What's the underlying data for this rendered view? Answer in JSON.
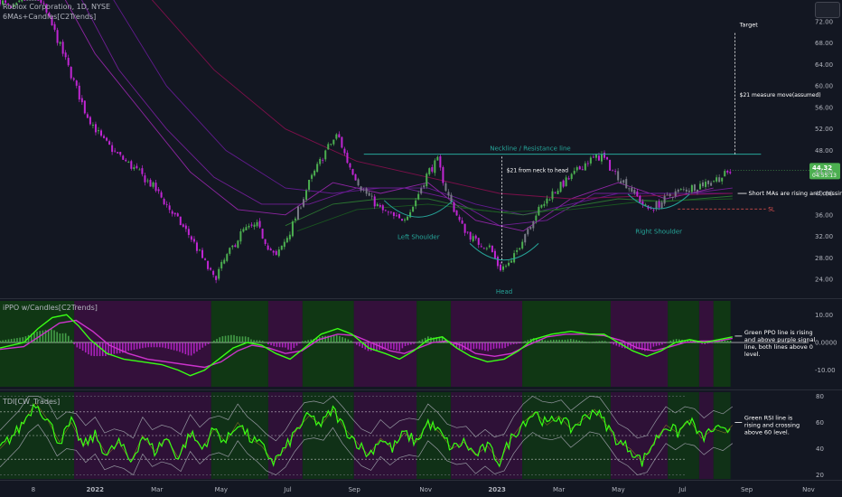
{
  "header": {
    "ticker": "Roblox Corporation, 1D, NYSE",
    "ma_indicator": "6MAs+Candles[C2Trends]"
  },
  "ppo_indicator": {
    "label": "iPPO w/Candles[C2Trends]"
  },
  "rsi_indicator": {
    "label": "TDI[CW_Trades]"
  },
  "colors": {
    "background": "#131722",
    "bull_candle": "#4caf50",
    "bear_candle": "#c026d3",
    "neutral_candle": "#787b86",
    "neckline": "#26a69a",
    "annotation": "#26a69a",
    "note": "#ffffff",
    "stop_loss": "#ef5350",
    "signal_line": "#cc33cc",
    "ppo_line": "#39ff14",
    "bull_zone": "#103d12",
    "bear_zone": "#3b0f40"
  },
  "chart_data": [
    {
      "type": "candlestick",
      "ticker": "Roblox Corporation, 1D, NYSE",
      "x_ticks": [
        "8",
        "2022",
        "Mar",
        "May",
        "Jul",
        "Sep",
        "Nov",
        "2023",
        "Mar",
        "May",
        "Jul",
        "Sep",
        "Nov"
      ],
      "y_ticks": [
        24,
        28,
        32,
        36,
        40,
        44,
        48,
        52,
        56,
        60,
        64,
        68,
        72
      ],
      "y_tick_labels": [
        "24.00",
        "28.00",
        "32.00",
        "36.00",
        "40.00",
        "44.00",
        "48.00",
        "52.00",
        "56.00",
        "60.00",
        "64.00",
        "68.00",
        "72.00"
      ],
      "ylim": [
        21,
        76
      ],
      "close_path": [
        [
          0,
          76
        ],
        [
          0.5,
          74
        ],
        [
          1.5,
          78
        ],
        [
          2.3,
          70
        ],
        [
          3.0,
          62
        ],
        [
          3.6,
          55
        ],
        [
          4.3,
          50
        ],
        [
          5.0,
          47
        ],
        [
          5.8,
          44
        ],
        [
          6.5,
          41
        ],
        [
          7.3,
          36
        ],
        [
          8.0,
          32
        ],
        [
          8.5,
          28
        ],
        [
          9.0,
          24
        ],
        [
          9.5,
          28
        ],
        [
          10.2,
          33
        ],
        [
          10.8,
          34
        ],
        [
          11.3,
          30
        ],
        [
          11.6,
          28
        ],
        [
          12.2,
          33
        ],
        [
          13.0,
          42
        ],
        [
          13.7,
          48
        ],
        [
          14.2,
          51
        ],
        [
          14.6,
          46
        ],
        [
          15.2,
          41
        ],
        [
          16.0,
          37
        ],
        [
          16.8,
          35
        ],
        [
          17.3,
          37
        ],
        [
          18.0,
          44
        ],
        [
          18.4,
          46
        ],
        [
          18.8,
          40
        ],
        [
          19.4,
          34
        ],
        [
          20.0,
          31
        ],
        [
          20.6,
          30
        ],
        [
          21.0,
          26
        ],
        [
          21.5,
          27
        ],
        [
          22.0,
          32
        ],
        [
          22.5,
          36
        ],
        [
          23.2,
          40
        ],
        [
          24.0,
          43
        ],
        [
          24.7,
          46
        ],
        [
          25.3,
          47
        ],
        [
          25.8,
          44
        ],
        [
          26.5,
          41
        ],
        [
          27.2,
          37
        ],
        [
          27.7,
          38
        ],
        [
          28.3,
          40
        ],
        [
          29.0,
          41
        ],
        [
          29.7,
          42
        ],
        [
          30.3,
          43
        ],
        [
          30.8,
          44.3
        ]
      ],
      "moving_averages": [
        {
          "name": "MA1",
          "color": "#9c27b0",
          "points": [
            [
              2.5,
              78
            ],
            [
              4,
              66
            ],
            [
              6,
              55
            ],
            [
              8,
              44
            ],
            [
              10,
              37
            ],
            [
              12,
              36
            ],
            [
              14,
              42
            ],
            [
              16,
              40
            ],
            [
              18,
              42
            ],
            [
              20,
              35
            ],
            [
              22,
              33
            ],
            [
              24,
              39
            ],
            [
              26,
              42
            ],
            [
              28,
              39
            ],
            [
              30,
              41
            ]
          ]
        },
        {
          "name": "MA2",
          "color": "#7b1fa2",
          "points": [
            [
              3.2,
              78
            ],
            [
              5,
              63
            ],
            [
              7,
              52
            ],
            [
              9,
              43
            ],
            [
              11,
              38
            ],
            [
              13,
              38
            ],
            [
              15,
              41
            ],
            [
              17,
              41
            ],
            [
              19,
              39
            ],
            [
              21,
              34
            ],
            [
              23,
              35
            ],
            [
              25,
              40
            ],
            [
              27,
              40
            ],
            [
              29,
              40
            ],
            [
              30.8,
              41
            ]
          ]
        },
        {
          "name": "MA3",
          "color": "#6a1b9a",
          "points": [
            [
              4.5,
              78
            ],
            [
              7,
              60
            ],
            [
              9.5,
              48
            ],
            [
              12,
              41
            ],
            [
              14,
              40
            ],
            [
              16,
              41
            ],
            [
              18,
              41
            ],
            [
              20,
              38
            ],
            [
              22,
              36
            ],
            [
              24,
              38
            ],
            [
              26,
              40
            ],
            [
              28,
              40
            ],
            [
              30.8,
              40
            ]
          ]
        },
        {
          "name": "MA4",
          "color": "#880e4f",
          "points": [
            [
              6,
              78
            ],
            [
              9,
              63
            ],
            [
              12,
              52
            ],
            [
              15,
              46
            ],
            [
              18,
              43
            ],
            [
              21,
              40
            ],
            [
              24,
              39
            ],
            [
              27,
              39.5
            ],
            [
              30.8,
              40
            ]
          ]
        },
        {
          "name": "MA5",
          "color": "#2e7d32",
          "points": [
            [
              12,
              34
            ],
            [
              14,
              38
            ],
            [
              16,
              39
            ],
            [
              18,
              39
            ],
            [
              20,
              37
            ],
            [
              22,
              36
            ],
            [
              24,
              37.5
            ],
            [
              26,
              39
            ],
            [
              28,
              38.5
            ],
            [
              30.8,
              39.5
            ]
          ]
        },
        {
          "name": "MA6",
          "color": "#1b5e20",
          "points": [
            [
              12.5,
              33
            ],
            [
              15,
              37
            ],
            [
              18,
              38
            ],
            [
              21,
              36.5
            ],
            [
              24,
              37
            ],
            [
              27,
              38.5
            ],
            [
              30.8,
              39
            ]
          ]
        }
      ],
      "annotations": [
        {
          "id": "neckline",
          "text": "Neckline / Resistance line",
          "value": 47.3,
          "x_start": 15.3,
          "x_end": 32
        },
        {
          "id": "left-shoulder",
          "text": "Left Shoulder",
          "x": 17.6,
          "y": 31.5
        },
        {
          "id": "head",
          "text": "Head",
          "x": 21.2,
          "y": 21.3
        },
        {
          "id": "right-shoulder",
          "text": "Right Shoulder",
          "x": 27.7,
          "y": 32.5
        },
        {
          "id": "measure-head",
          "text": "$21 from neck to head",
          "x": 21.3,
          "y": 44
        },
        {
          "id": "target",
          "text": "Target",
          "x": 31.1,
          "y": 71
        },
        {
          "id": "measure-target",
          "text": "$21 measure move(assumed)",
          "x": 31.1,
          "y": 58
        },
        {
          "id": "ma-note",
          "text": "Short MAs are rising and crossing above long MAs.",
          "x": 31.4,
          "y": 40
        },
        {
          "id": "stop-loss",
          "text": "SL",
          "value": 37.1
        }
      ],
      "last_price": {
        "value": "44.32",
        "countdown": "04:55:13"
      }
    },
    {
      "type": "line",
      "name": "iPPO w/Candles[C2Trends]",
      "y_ticks": [
        10,
        0,
        -10
      ],
      "y_tick_labels": [
        "10.00",
        "0.0000",
        "-10.00"
      ],
      "ylim": [
        -16,
        15
      ],
      "ppo_path": [
        [
          0,
          -2
        ],
        [
          1,
          0
        ],
        [
          1.6,
          5
        ],
        [
          2.2,
          9
        ],
        [
          2.8,
          10
        ],
        [
          3.3,
          6
        ],
        [
          3.8,
          1
        ],
        [
          4.5,
          -4
        ],
        [
          5.2,
          -6
        ],
        [
          6.0,
          -7
        ],
        [
          6.8,
          -8
        ],
        [
          7.5,
          -10
        ],
        [
          8.0,
          -12
        ],
        [
          8.6,
          -10
        ],
        [
          9.2,
          -6
        ],
        [
          9.8,
          -2
        ],
        [
          10.4,
          0
        ],
        [
          11.0,
          -1
        ],
        [
          11.6,
          -4
        ],
        [
          12.2,
          -6
        ],
        [
          12.8,
          -2
        ],
        [
          13.5,
          3
        ],
        [
          14.2,
          5
        ],
        [
          14.8,
          3
        ],
        [
          15.5,
          -2
        ],
        [
          16.2,
          -4
        ],
        [
          16.8,
          -6
        ],
        [
          17.4,
          -3
        ],
        [
          18.0,
          1
        ],
        [
          18.6,
          2
        ],
        [
          19.2,
          -2
        ],
        [
          19.8,
          -5
        ],
        [
          20.5,
          -7
        ],
        [
          21.2,
          -6
        ],
        [
          21.8,
          -3
        ],
        [
          22.4,
          1
        ],
        [
          23.2,
          3
        ],
        [
          24.0,
          4
        ],
        [
          24.8,
          3
        ],
        [
          25.4,
          3
        ],
        [
          26.0,
          0
        ],
        [
          26.6,
          -3
        ],
        [
          27.2,
          -5
        ],
        [
          27.8,
          -3
        ],
        [
          28.4,
          0
        ],
        [
          29.0,
          1
        ],
        [
          29.6,
          0
        ],
        [
          30.2,
          1
        ],
        [
          30.8,
          2
        ]
      ],
      "signal_path": [
        [
          0,
          -2.5
        ],
        [
          1,
          -1.5
        ],
        [
          1.8,
          3
        ],
        [
          2.5,
          7
        ],
        [
          3.2,
          8
        ],
        [
          3.9,
          4
        ],
        [
          4.6,
          -1
        ],
        [
          5.4,
          -4
        ],
        [
          6.2,
          -6
        ],
        [
          7.0,
          -7
        ],
        [
          7.8,
          -8
        ],
        [
          8.6,
          -9
        ],
        [
          9.3,
          -7
        ],
        [
          10.0,
          -3
        ],
        [
          10.6,
          -1
        ],
        [
          11.3,
          -2
        ],
        [
          12.0,
          -4
        ],
        [
          12.7,
          -3
        ],
        [
          13.4,
          1
        ],
        [
          14.2,
          3
        ],
        [
          14.9,
          2.5
        ],
        [
          15.6,
          0
        ],
        [
          16.4,
          -3
        ],
        [
          17.0,
          -4
        ],
        [
          17.6,
          -2
        ],
        [
          18.2,
          0
        ],
        [
          18.8,
          0.5
        ],
        [
          19.4,
          -1
        ],
        [
          20.0,
          -4
        ],
        [
          20.8,
          -5
        ],
        [
          21.5,
          -4
        ],
        [
          22.2,
          -1
        ],
        [
          23.0,
          2
        ],
        [
          23.8,
          3
        ],
        [
          24.6,
          3
        ],
        [
          25.4,
          2.5
        ],
        [
          26.2,
          0.5
        ],
        [
          26.8,
          -2
        ],
        [
          27.5,
          -3
        ],
        [
          28.2,
          -1.5
        ],
        [
          28.8,
          0
        ],
        [
          29.5,
          0.5
        ],
        [
          30.2,
          0.5
        ],
        [
          30.8,
          1.5
        ]
      ],
      "note": "Green PPO line is rising and above purple signal line, both lines above 0 level."
    },
    {
      "type": "line",
      "name": "TDI[CW_Trades]",
      "y_ticks": [
        20,
        40,
        60,
        80
      ],
      "y_tick_labels": [
        "20",
        "40",
        "60",
        "80"
      ],
      "ylim": [
        17,
        83
      ],
      "levels": [
        32,
        50,
        68
      ],
      "rsi_path": [
        [
          0,
          40
        ],
        [
          0.8,
          55
        ],
        [
          1.5,
          75
        ],
        [
          2.0,
          62
        ],
        [
          2.5,
          45
        ],
        [
          3.0,
          60
        ],
        [
          3.5,
          42
        ],
        [
          4.0,
          50
        ],
        [
          4.5,
          35
        ],
        [
          5.0,
          45
        ],
        [
          5.5,
          30
        ],
        [
          6.0,
          50
        ],
        [
          6.5,
          38
        ],
        [
          7.0,
          48
        ],
        [
          7.5,
          33
        ],
        [
          8.0,
          52
        ],
        [
          8.5,
          40
        ],
        [
          9.0,
          55
        ],
        [
          9.5,
          45
        ],
        [
          10.0,
          60
        ],
        [
          10.5,
          48
        ],
        [
          11.0,
          42
        ],
        [
          11.5,
          30
        ],
        [
          12.0,
          40
        ],
        [
          12.5,
          55
        ],
        [
          13.0,
          65
        ],
        [
          13.5,
          58
        ],
        [
          14.0,
          70
        ],
        [
          14.5,
          55
        ],
        [
          15.0,
          45
        ],
        [
          15.5,
          35
        ],
        [
          16.0,
          48
        ],
        [
          16.5,
          40
        ],
        [
          17.0,
          52
        ],
        [
          17.5,
          45
        ],
        [
          18.0,
          60
        ],
        [
          18.5,
          52
        ],
        [
          19.0,
          40
        ],
        [
          19.5,
          45
        ],
        [
          20.0,
          35
        ],
        [
          20.5,
          42
        ],
        [
          21.0,
          30
        ],
        [
          21.5,
          48
        ],
        [
          22.0,
          60
        ],
        [
          22.5,
          68
        ],
        [
          23.0,
          58
        ],
        [
          23.5,
          65
        ],
        [
          24.0,
          55
        ],
        [
          24.5,
          62
        ],
        [
          25.0,
          70
        ],
        [
          25.5,
          58
        ],
        [
          26.0,
          45
        ],
        [
          26.5,
          40
        ],
        [
          27.0,
          30
        ],
        [
          27.5,
          45
        ],
        [
          28.0,
          58
        ],
        [
          28.5,
          52
        ],
        [
          29.0,
          62
        ],
        [
          29.5,
          48
        ],
        [
          30.0,
          55
        ],
        [
          30.5,
          52
        ],
        [
          30.8,
          58
        ]
      ],
      "note": "Green RSI line is rising and crossing above 60 level."
    }
  ]
}
